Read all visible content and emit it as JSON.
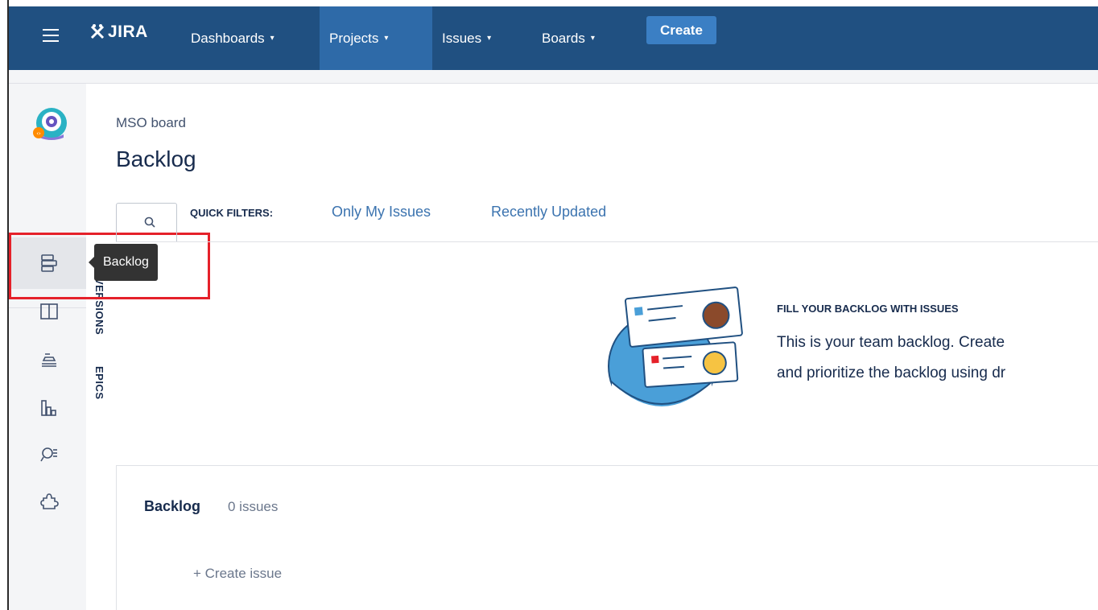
{
  "nav": {
    "logo_text": "JIRA",
    "items": [
      {
        "label": "Dashboards",
        "caret": "▾"
      },
      {
        "label": "Projects",
        "caret": "▾"
      },
      {
        "label": "Issues",
        "caret": "▾"
      },
      {
        "label": "Boards",
        "caret": "▾"
      }
    ],
    "create_label": "Create",
    "brand_color": "#205081",
    "active_item": "Projects"
  },
  "sidebar": {
    "more_label": "•••",
    "icons": [
      "backlog-icon",
      "board-icon",
      "releases-icon",
      "reports-icon",
      "issues-search-icon",
      "add-ons-icon"
    ],
    "active": "backlog-icon"
  },
  "tooltip": {
    "text": "Backlog"
  },
  "vertical_tabs": [
    {
      "label": "VERSIONS"
    },
    {
      "label": "EPICS"
    }
  ],
  "header": {
    "breadcrumb": "MSO board",
    "title": "Backlog"
  },
  "quick_filters": {
    "label": "QUICK FILTERS:",
    "filters": [
      "Only My Issues",
      "Recently Updated"
    ]
  },
  "empty_state": {
    "heading": "FILL YOUR BACKLOG WITH ISSUES",
    "line1": "This is your team backlog. Create",
    "line2": "and prioritize the backlog using dr"
  },
  "backlog_section": {
    "title": "Backlog",
    "count": "0 issues",
    "create_issue": "+ Create issue"
  }
}
